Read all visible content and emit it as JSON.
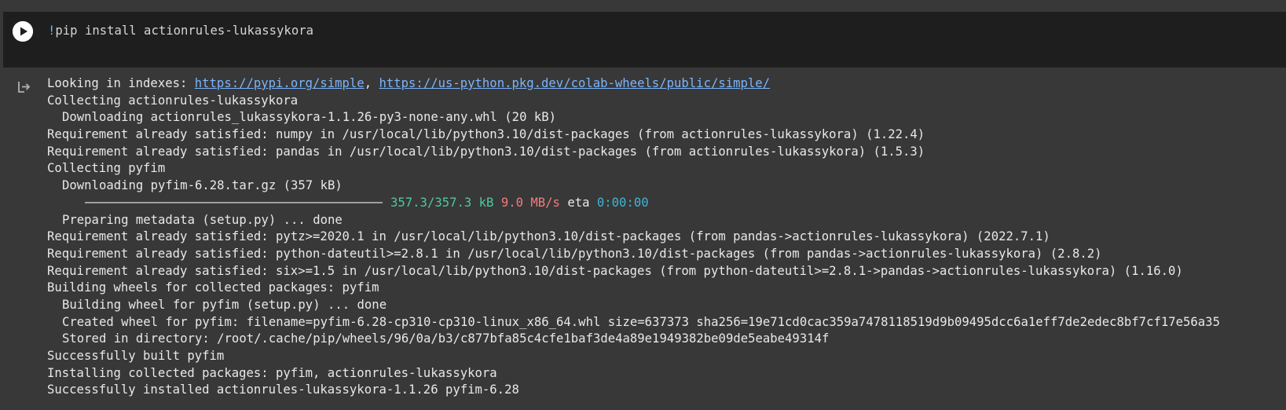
{
  "code_cell": {
    "bang": "!",
    "command": "pip install actionrules-lukassykora"
  },
  "output": {
    "line1_prefix": "Looking in indexes: ",
    "link1": "https://pypi.org/simple",
    "line1_sep": ", ",
    "link2": "https://us-python.pkg.dev/colab-wheels/public/simple/",
    "line2": "Collecting actionrules-lukassykora",
    "line3": "Downloading actionrules_lukassykora-1.1.26-py3-none-any.whl (20 kB)",
    "line4": "Requirement already satisfied: numpy in /usr/local/lib/python3.10/dist-packages (from actionrules-lukassykora) (1.22.4)",
    "line5": "Requirement already satisfied: pandas in /usr/local/lib/python3.10/dist-packages (from actionrules-lukassykora) (1.5.3)",
    "line6": "Collecting pyfim",
    "line7": "Downloading pyfim-6.28.tar.gz (357 kB)",
    "progress": {
      "fraction": 1.0,
      "size": "357.3/357.3 kB",
      "speed": "9.0 MB/s",
      "eta_label": "eta",
      "eta": "0:00:00"
    },
    "line9": "Preparing metadata (setup.py) ... done",
    "line10": "Requirement already satisfied: pytz>=2020.1 in /usr/local/lib/python3.10/dist-packages (from pandas->actionrules-lukassykora) (2022.7.1)",
    "line11": "Requirement already satisfied: python-dateutil>=2.8.1 in /usr/local/lib/python3.10/dist-packages (from pandas->actionrules-lukassykora) (2.8.2)",
    "line12": "Requirement already satisfied: six>=1.5 in /usr/local/lib/python3.10/dist-packages (from python-dateutil>=2.8.1->pandas->actionrules-lukassykora) (1.16.0)",
    "line13": "Building wheels for collected packages: pyfim",
    "line14": "Building wheel for pyfim (setup.py) ... done",
    "line15": "Created wheel for pyfim: filename=pyfim-6.28-cp310-cp310-linux_x86_64.whl size=637373 sha256=19e71cd0cac359a7478118519d9b09495dcc6a1eff7de2edec8bf7cf17e56a35",
    "line16": "Stored in directory: /root/.cache/pip/wheels/96/0a/b3/c877bfa85c4cfe1baf3de4a89e1949382be09de5eabe49314f",
    "line17": "Successfully built pyfim",
    "line18": "Installing collected packages: pyfim, actionrules-lukassykora",
    "line19": "Successfully installed actionrules-lukassykora-1.1.26 pyfim-6.28"
  },
  "icons": {
    "run": "play-circle-icon",
    "output": "output-arrow-icon"
  },
  "colors": {
    "background": "#383838",
    "code_background": "#1e1e1e",
    "link": "#7ab5ff",
    "progress_size": "#4ec9a0",
    "progress_speed": "#f47c7c",
    "progress_eta": "#3fb6d6"
  }
}
